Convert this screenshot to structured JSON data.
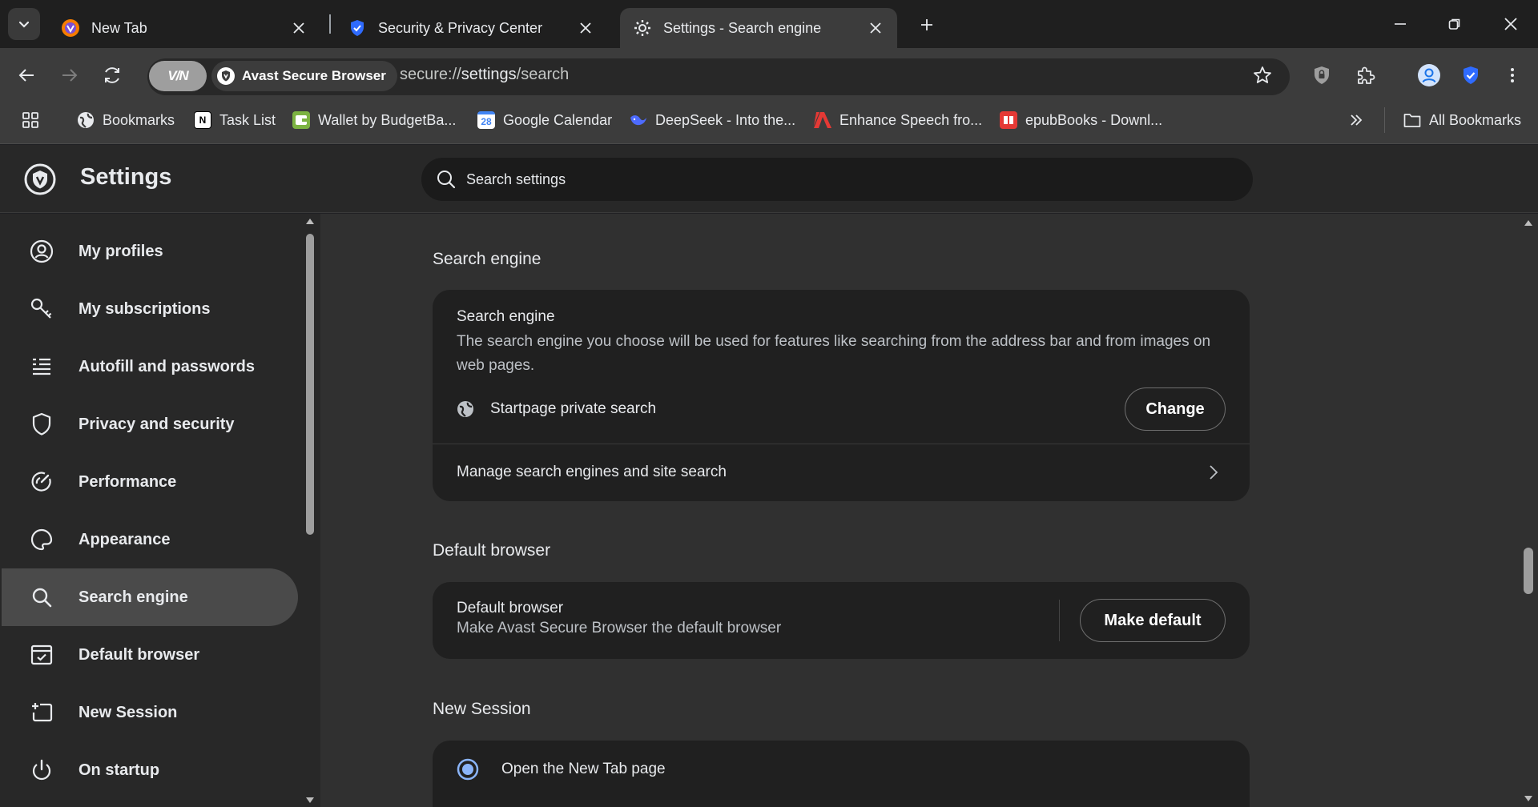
{
  "tabs": [
    {
      "title": "New Tab"
    },
    {
      "title": "Security & Privacy Center"
    },
    {
      "title": "Settings - Search engine"
    }
  ],
  "omnibox": {
    "vpn_label": "V/N",
    "browser_label": "Avast Secure Browser",
    "url_prefix": "secure://",
    "url_host": "settings",
    "url_path": "/search"
  },
  "bookmarks": [
    {
      "label": "Bookmarks",
      "color": "#5f6368"
    },
    {
      "label": "Task List",
      "color": "#ffffff"
    },
    {
      "label": "Wallet by BudgetBa...",
      "color": "#7cb342"
    },
    {
      "label": "Google Calendar",
      "color": "#4285f4"
    },
    {
      "label": "DeepSeek - Into the...",
      "color": "#4d6bfe"
    },
    {
      "label": "Enhance Speech fro...",
      "color": "#e53935"
    },
    {
      "label": "epubBooks - Downl...",
      "color": "#e53935"
    }
  ],
  "all_bookmarks_label": "All Bookmarks",
  "settings": {
    "title": "Settings",
    "search_placeholder": "Search settings"
  },
  "sidebar": {
    "items": [
      {
        "label": "My profiles",
        "icon": "profile-icon"
      },
      {
        "label": "My subscriptions",
        "icon": "key-icon"
      },
      {
        "label": "Autofill and passwords",
        "icon": "list-icon"
      },
      {
        "label": "Privacy and security",
        "icon": "shield-icon"
      },
      {
        "label": "Performance",
        "icon": "speedometer-icon"
      },
      {
        "label": "Appearance",
        "icon": "palette-icon"
      },
      {
        "label": "Search engine",
        "icon": "search-icon",
        "active": true
      },
      {
        "label": "Default browser",
        "icon": "browser-window-icon"
      },
      {
        "label": "New Session",
        "icon": "new-session-icon"
      },
      {
        "label": "On startup",
        "icon": "power-icon"
      }
    ]
  },
  "search_engine_section": {
    "heading": "Search engine",
    "row_title": "Search engine",
    "row_desc": "The search engine you choose will be used for features like searching from the address bar and from images on web pages.",
    "current_engine": "Startpage private search",
    "change_label": "Change",
    "manage_label": "Manage search engines and site search"
  },
  "default_browser_section": {
    "heading": "Default browser",
    "row_title": "Default browser",
    "row_desc": "Make Avast Secure Browser the default browser",
    "button_label": "Make default"
  },
  "new_session_section": {
    "heading": "New Session",
    "option_label": "Open the New Tab page"
  }
}
